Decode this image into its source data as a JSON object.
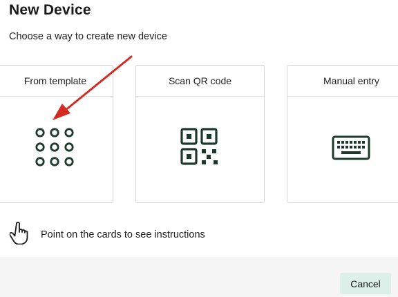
{
  "dialog": {
    "title": "New Device",
    "subtitle": "Choose a way to create new device"
  },
  "cards": [
    {
      "label": "From template",
      "icon": "grid-dots-icon"
    },
    {
      "label": "Scan QR code",
      "icon": "qr-code-icon"
    },
    {
      "label": "Manual entry",
      "icon": "keyboard-icon"
    }
  ],
  "hint": {
    "icon": "hand-pointer-icon",
    "text": "Point on the cards to see instructions"
  },
  "footer": {
    "cancel_label": "Cancel"
  },
  "colors": {
    "icon": "#1b3a2a",
    "cancel_bg": "#dcefe8",
    "annotation_arrow": "#d42a20"
  }
}
